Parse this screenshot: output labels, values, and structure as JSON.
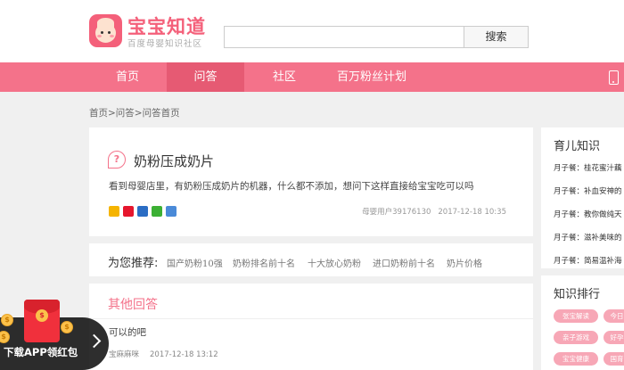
{
  "header": {
    "logo_title": "宝宝知道",
    "logo_subtitle": "百度母婴知识社区",
    "search_placeholder": "",
    "search_button": "搜索"
  },
  "nav": {
    "items": [
      {
        "label": "首页",
        "active": false
      },
      {
        "label": "问答",
        "active": true
      },
      {
        "label": "社区",
        "active": false
      },
      {
        "label": "百万粉丝计划",
        "active": false
      }
    ]
  },
  "breadcrumb": "首页>问答>问答首页",
  "question": {
    "title": "奶粉压成奶片",
    "body": "看到母婴店里，有奶粉压成奶片的机器，什么都不添加，想问下这样直接给宝宝吃可以吗",
    "author": "母婴用户39176130",
    "time": "2017-12-18 10:35",
    "share_icons": [
      "qzone-icon",
      "weibo-icon",
      "renren-icon",
      "wechat-icon",
      "more-share-icon"
    ]
  },
  "recommend": {
    "label": "为您推荐:",
    "links": [
      "国产奶粉10强",
      "奶粉排名前十名",
      "十大放心奶粉",
      "进口奶粉前十名",
      "奶片价格"
    ]
  },
  "answers": {
    "title": "其他回答",
    "items": [
      {
        "text": "可以的吧",
        "author": "宝麻麻咪",
        "time": "2017-12-18 13:12"
      }
    ]
  },
  "sidebar": {
    "knowledge_title": "育儿知识",
    "knowledge_items": [
      "月子餐：桂花蜜汁藕",
      "月子餐：补血安神的",
      "月子餐：教你做纯天",
      "月子餐：滋补美味的",
      "月子餐：简易温补海"
    ],
    "ranking_title": "知识排行",
    "ranking_tags": [
      "张宝解读",
      "今日",
      "亲子游戏",
      "好孕",
      "宝宝健康",
      "国育"
    ]
  },
  "promo": {
    "text": "下载APP领红包",
    "coin_symbol": "$"
  },
  "colors": {
    "brand_pink": "#f4728a",
    "nav_active": "#e65a73",
    "logo_pink": "#f4607a"
  }
}
